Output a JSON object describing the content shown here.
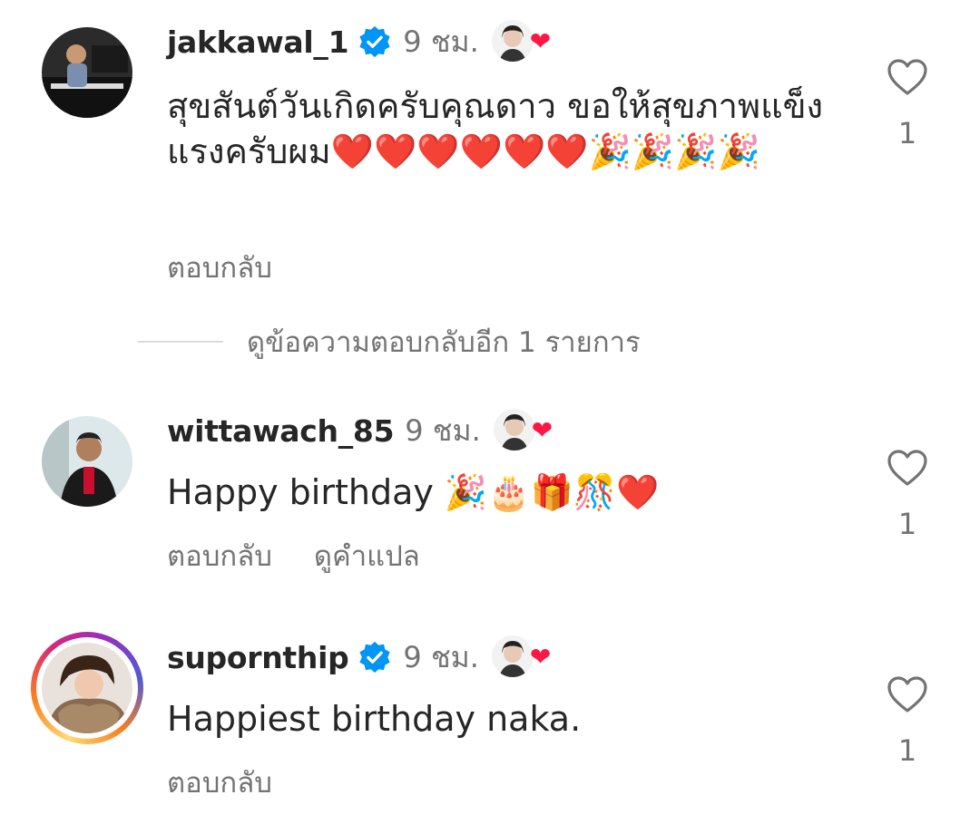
{
  "comments": [
    {
      "username": "jakkawal_1",
      "verified": true,
      "time": "9 ชม.",
      "text": "สุขสันต์วันเกิดครับคุณดาว ขอให้สุขภาพแข็งแรงครับผม❤️❤️❤️❤️❤️❤️🎉🎉🎉🎉",
      "actions": [
        "ตอบกลับ"
      ],
      "like_count": "1",
      "view_replies": "ดูข้อความตอบกลับอีก 1 รายการ"
    },
    {
      "username": "wittawach_85",
      "verified": false,
      "time": "9 ชม.",
      "text": "Happy birthday 🎉🎂🎁🎊❤️",
      "actions": [
        "ตอบกลับ",
        "ดูคำแปล"
      ],
      "like_count": "1"
    },
    {
      "username": "supornthip",
      "verified": true,
      "time": "9 ชม.",
      "text": "Happiest birthday naka.",
      "actions": [
        "ตอบกลับ"
      ],
      "like_count": "1"
    }
  ],
  "colors": {
    "verified_blue": "#0095f6",
    "creator_heart": "#ff1744",
    "secondary_text": "#737373"
  },
  "icons": {
    "like": "heart-outline-icon",
    "verified": "verified-badge-icon",
    "creator_like": "creator-liked-heart-icon"
  }
}
